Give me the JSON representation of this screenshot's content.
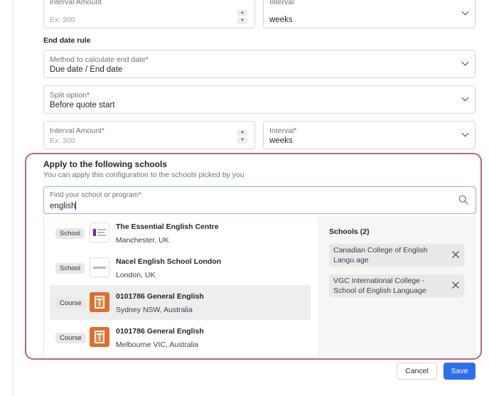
{
  "top_row": {
    "interval_amount": {
      "label": "Interval Amount",
      "placeholder": "Ex: 300"
    },
    "interval": {
      "label": "Interval",
      "value": "weeks"
    }
  },
  "end_date_rule": {
    "title": "End date rule",
    "method": {
      "label": "Method to calculate end date*",
      "value": "Due date / End date"
    },
    "split": {
      "label": "Split option*",
      "value": "Before quote start"
    },
    "interval_amount": {
      "label": "Interval Amount*",
      "placeholder": "Ex: 300"
    },
    "interval": {
      "label": "Interval*",
      "value": "weeks"
    }
  },
  "apply": {
    "title": "Apply to the following schools",
    "subtitle": "You can apply this configuration to the schools picked by you",
    "search": {
      "label": "Find your school or program*",
      "value": "english"
    },
    "results": [
      {
        "type": "School",
        "name": "The Essential English Centre",
        "location": "Manchester, UK",
        "logo": "essential-english-logo"
      },
      {
        "type": "School",
        "name": "Nacel English School London",
        "location": "London, UK",
        "logo": "nacel-logo"
      },
      {
        "type": "Course",
        "name": "0101786 General English",
        "location": "Sydney NSW, Australia",
        "logo": "t-logo"
      },
      {
        "type": "Course",
        "name": "0101786 General English",
        "location": "Melbourne VIC, Australia",
        "logo": "t-logo"
      }
    ],
    "picked": {
      "title": "Schools (2)",
      "items": [
        "Canadian College of English Langu age",
        "VGC International College - School of English Language"
      ]
    }
  },
  "footer": {
    "cancel": "Cancel",
    "save": "Save"
  },
  "colors": {
    "accent": "#2f6fea",
    "highlight_border": "#c26087",
    "focus_border": "#8fb4da"
  }
}
